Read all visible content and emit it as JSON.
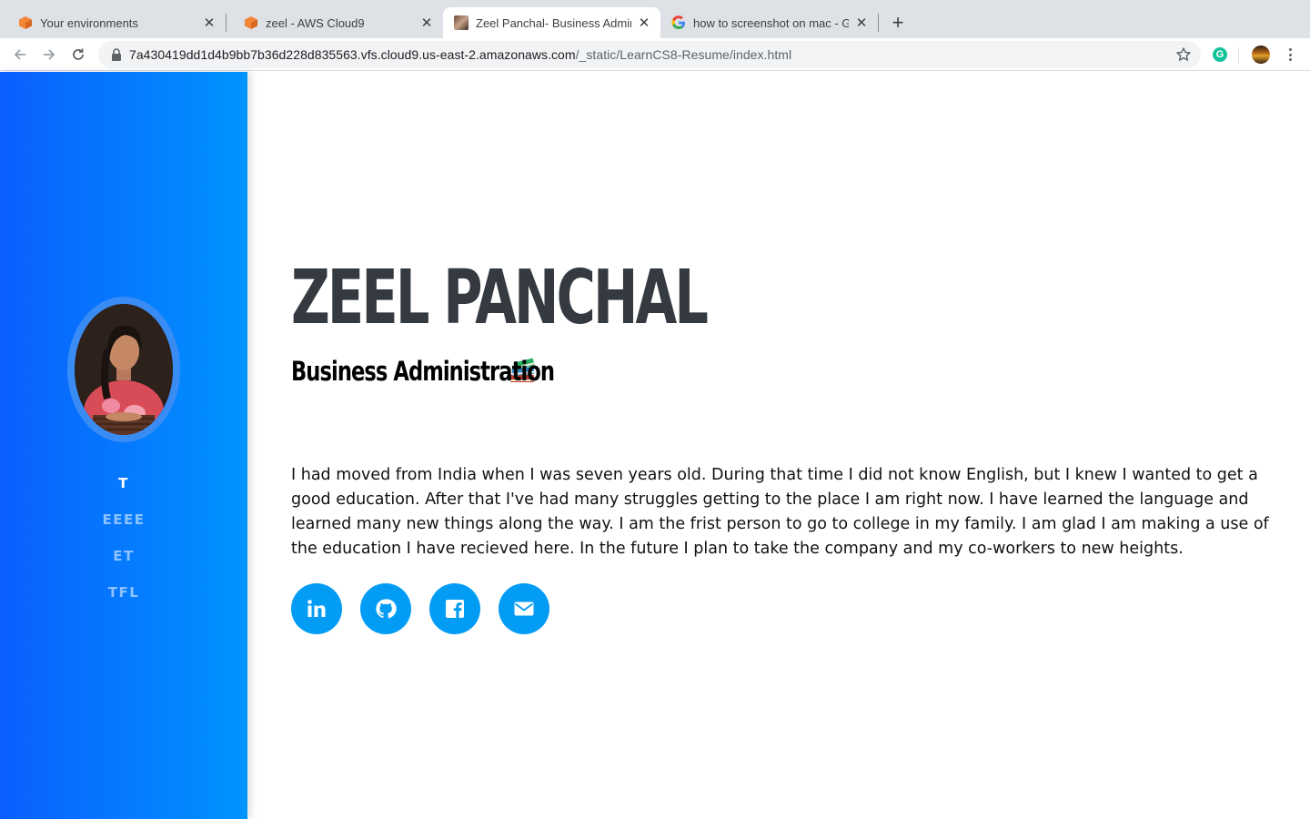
{
  "browser": {
    "tabs": [
      {
        "title": "Your environments",
        "favicon": "aws-cube-icon",
        "active": false
      },
      {
        "title": "zeel - AWS Cloud9",
        "favicon": "aws-cube-icon",
        "active": false
      },
      {
        "title": "Zeel Panchal- Business Admini",
        "favicon": "photo-icon",
        "active": true
      },
      {
        "title": "how to screenshot on mac - Go",
        "favicon": "google-g-icon",
        "active": false
      }
    ],
    "url_host": "7a430419dd1d4b9bb7b36d228d835563.vfs.cloud9.us-east-2.amazonaws.com",
    "url_path": "/_static/LearnCS8-Resume/index.html"
  },
  "sidebar": {
    "nav": [
      {
        "label": "T",
        "active": true
      },
      {
        "label": "EEEE",
        "active": false
      },
      {
        "label": "ET",
        "active": false
      },
      {
        "label": "TFL",
        "active": false
      }
    ]
  },
  "profile": {
    "name": "ZEEL PANCHAL",
    "subheading": "Business Administration",
    "about": "I had moved from India when I was seven years old. During that time I did not know English, but I knew I wanted to get a good education. After that I've had many struggles getting to the place I am right now. I have learned the language and learned many new things along the way. I am the frist person to go to college in my family. I am glad I am making a use of the education I have recieved here. In the future I plan to take the company and my co-workers to new heights.",
    "socials": [
      "linkedin-icon",
      "github-icon",
      "facebook-icon",
      "envelope-icon"
    ]
  },
  "colors": {
    "sidebar_start": "#0a5ffe",
    "sidebar_end": "#0094fd",
    "social_button": "#039cf5",
    "heading": "#343a40"
  }
}
